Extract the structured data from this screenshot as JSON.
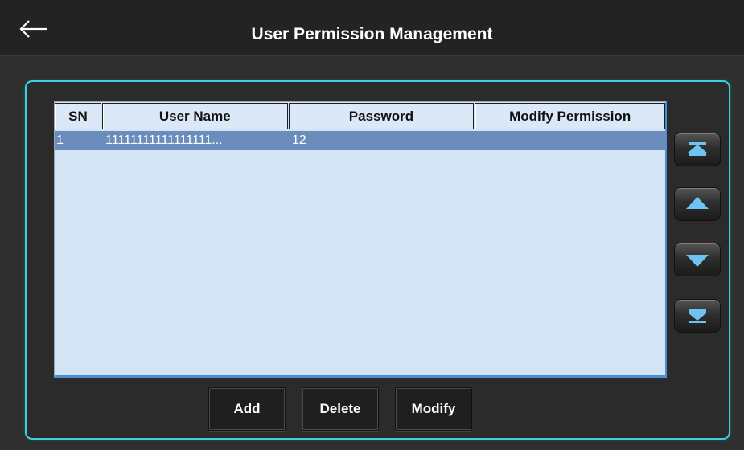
{
  "header": {
    "title": "User Permission Management",
    "back_icon": "arrow-left-icon"
  },
  "table": {
    "columns": [
      "SN",
      "User Name",
      "Password",
      "Modify Permission"
    ],
    "rows": [
      {
        "sn": "1",
        "user_name": "11111111111111111...",
        "password": "12",
        "modify_permission": "",
        "selected": true
      }
    ]
  },
  "navigation": {
    "buttons": [
      "scroll-top-icon",
      "scroll-up-icon",
      "scroll-down-icon",
      "scroll-bottom-icon"
    ]
  },
  "actions": {
    "add": "Add",
    "delete": "Delete",
    "modify": "Modify"
  },
  "colors": {
    "accent": "#38d4e0",
    "selected_row": "#6a8dbc",
    "table_bg": "#d3e5f5",
    "background": "#2f2f2f"
  }
}
